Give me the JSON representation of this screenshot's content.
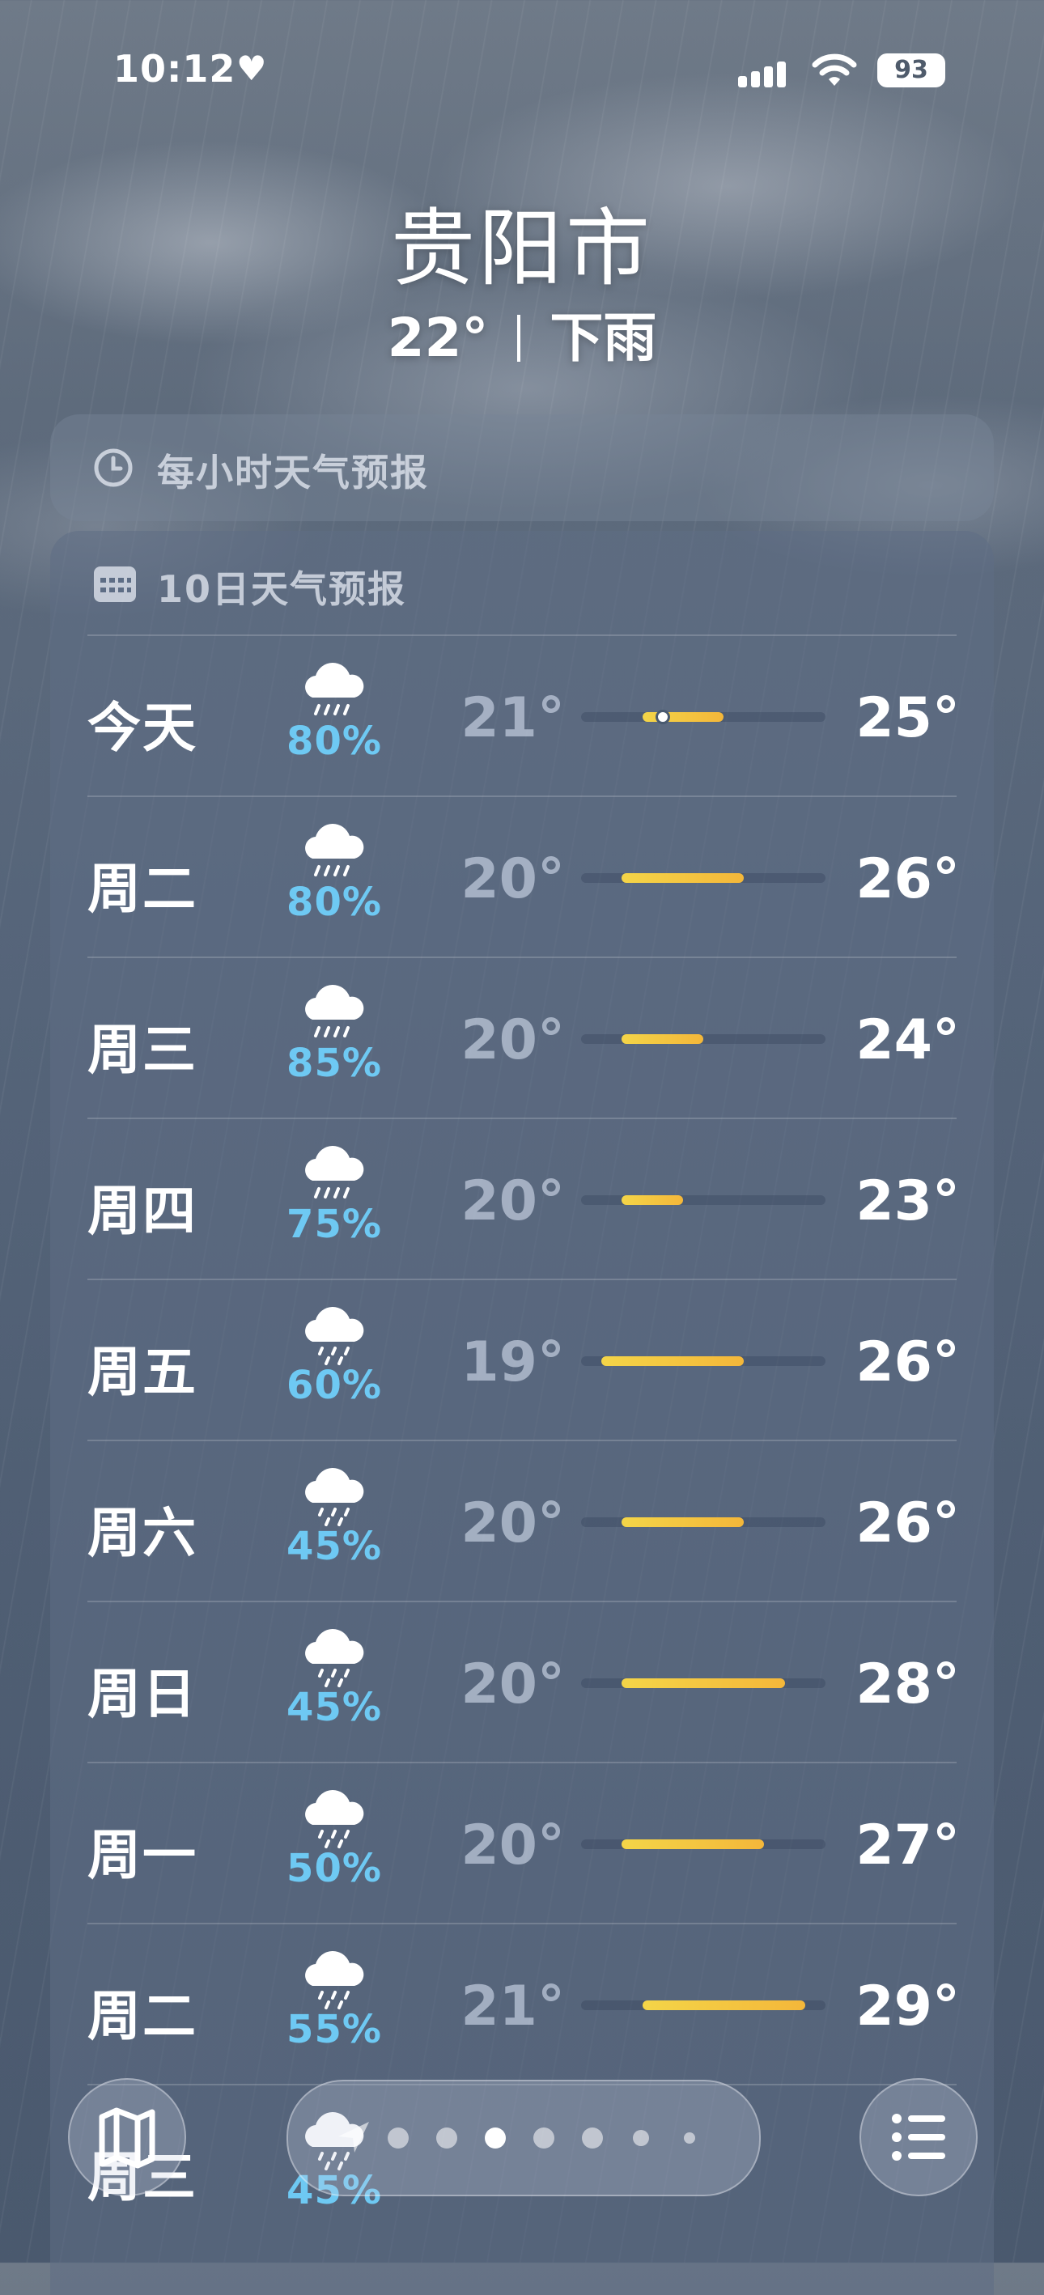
{
  "status": {
    "time": "10:12",
    "battery": "93"
  },
  "header": {
    "city": "贵阳市",
    "temp": "22°",
    "condition": "下雨"
  },
  "hourly": {
    "title": "每小时天气预报"
  },
  "daily": {
    "title": "10日天气预报",
    "rows": [
      {
        "day": "今天",
        "precip": "80%",
        "low": "21°",
        "high": "25°",
        "low_value": 21,
        "high_value": 25,
        "current_value": 22,
        "icon": "rain-cloud-icon"
      },
      {
        "day": "周二",
        "precip": "80%",
        "low": "20°",
        "high": "26°",
        "low_value": 20,
        "high_value": 26,
        "icon": "rain-cloud-icon"
      },
      {
        "day": "周三",
        "precip": "85%",
        "low": "20°",
        "high": "24°",
        "low_value": 20,
        "high_value": 24,
        "icon": "rain-cloud-icon"
      },
      {
        "day": "周四",
        "precip": "75%",
        "low": "20°",
        "high": "23°",
        "low_value": 20,
        "high_value": 23,
        "icon": "rain-cloud-icon"
      },
      {
        "day": "周五",
        "precip": "60%",
        "low": "19°",
        "high": "26°",
        "low_value": 19,
        "high_value": 26,
        "icon": "drizzle-cloud-icon"
      },
      {
        "day": "周六",
        "precip": "45%",
        "low": "20°",
        "high": "26°",
        "low_value": 20,
        "high_value": 26,
        "icon": "drizzle-cloud-icon"
      },
      {
        "day": "周日",
        "precip": "45%",
        "low": "20°",
        "high": "28°",
        "low_value": 20,
        "high_value": 28,
        "icon": "drizzle-cloud-icon"
      },
      {
        "day": "周一",
        "precip": "50%",
        "low": "20°",
        "high": "27°",
        "low_value": 20,
        "high_value": 27,
        "icon": "drizzle-cloud-icon"
      },
      {
        "day": "周二",
        "precip": "55%",
        "low": "21°",
        "high": "29°",
        "low_value": 21,
        "high_value": 29,
        "icon": "drizzle-cloud-icon"
      },
      {
        "day": "周三",
        "precip": "45%",
        "low": "",
        "high": "",
        "icon": "drizzle-cloud-icon"
      }
    ],
    "range_min": 18,
    "range_max": 30
  },
  "nav": {
    "pages": 7,
    "active_page": 3
  },
  "colors": {
    "precip": "#6ec9f3",
    "bar_start": "#f4d548",
    "bar_end": "#f4b73a"
  }
}
